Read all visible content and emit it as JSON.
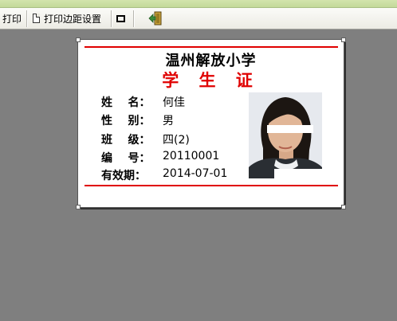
{
  "toolbar": {
    "print_label": "打印",
    "margin_label": "打印边距设置"
  },
  "card": {
    "school": "温州解放小学",
    "card_type": "学 生 证",
    "fields": [
      {
        "label": "姓    名：",
        "value": "何佳"
      },
      {
        "label": "性    别：",
        "value": "男"
      },
      {
        "label": "班    级：",
        "value": "四(2)"
      },
      {
        "label": "编    号：",
        "value": "20110001"
      },
      {
        "label": "有效期：",
        "value": "2014-07-01"
      }
    ]
  },
  "colors": {
    "accent_red": "#e00000",
    "workspace": "#7f7f7f"
  },
  "icons": [
    "document-icon",
    "frame-icon",
    "exit-icon"
  ]
}
